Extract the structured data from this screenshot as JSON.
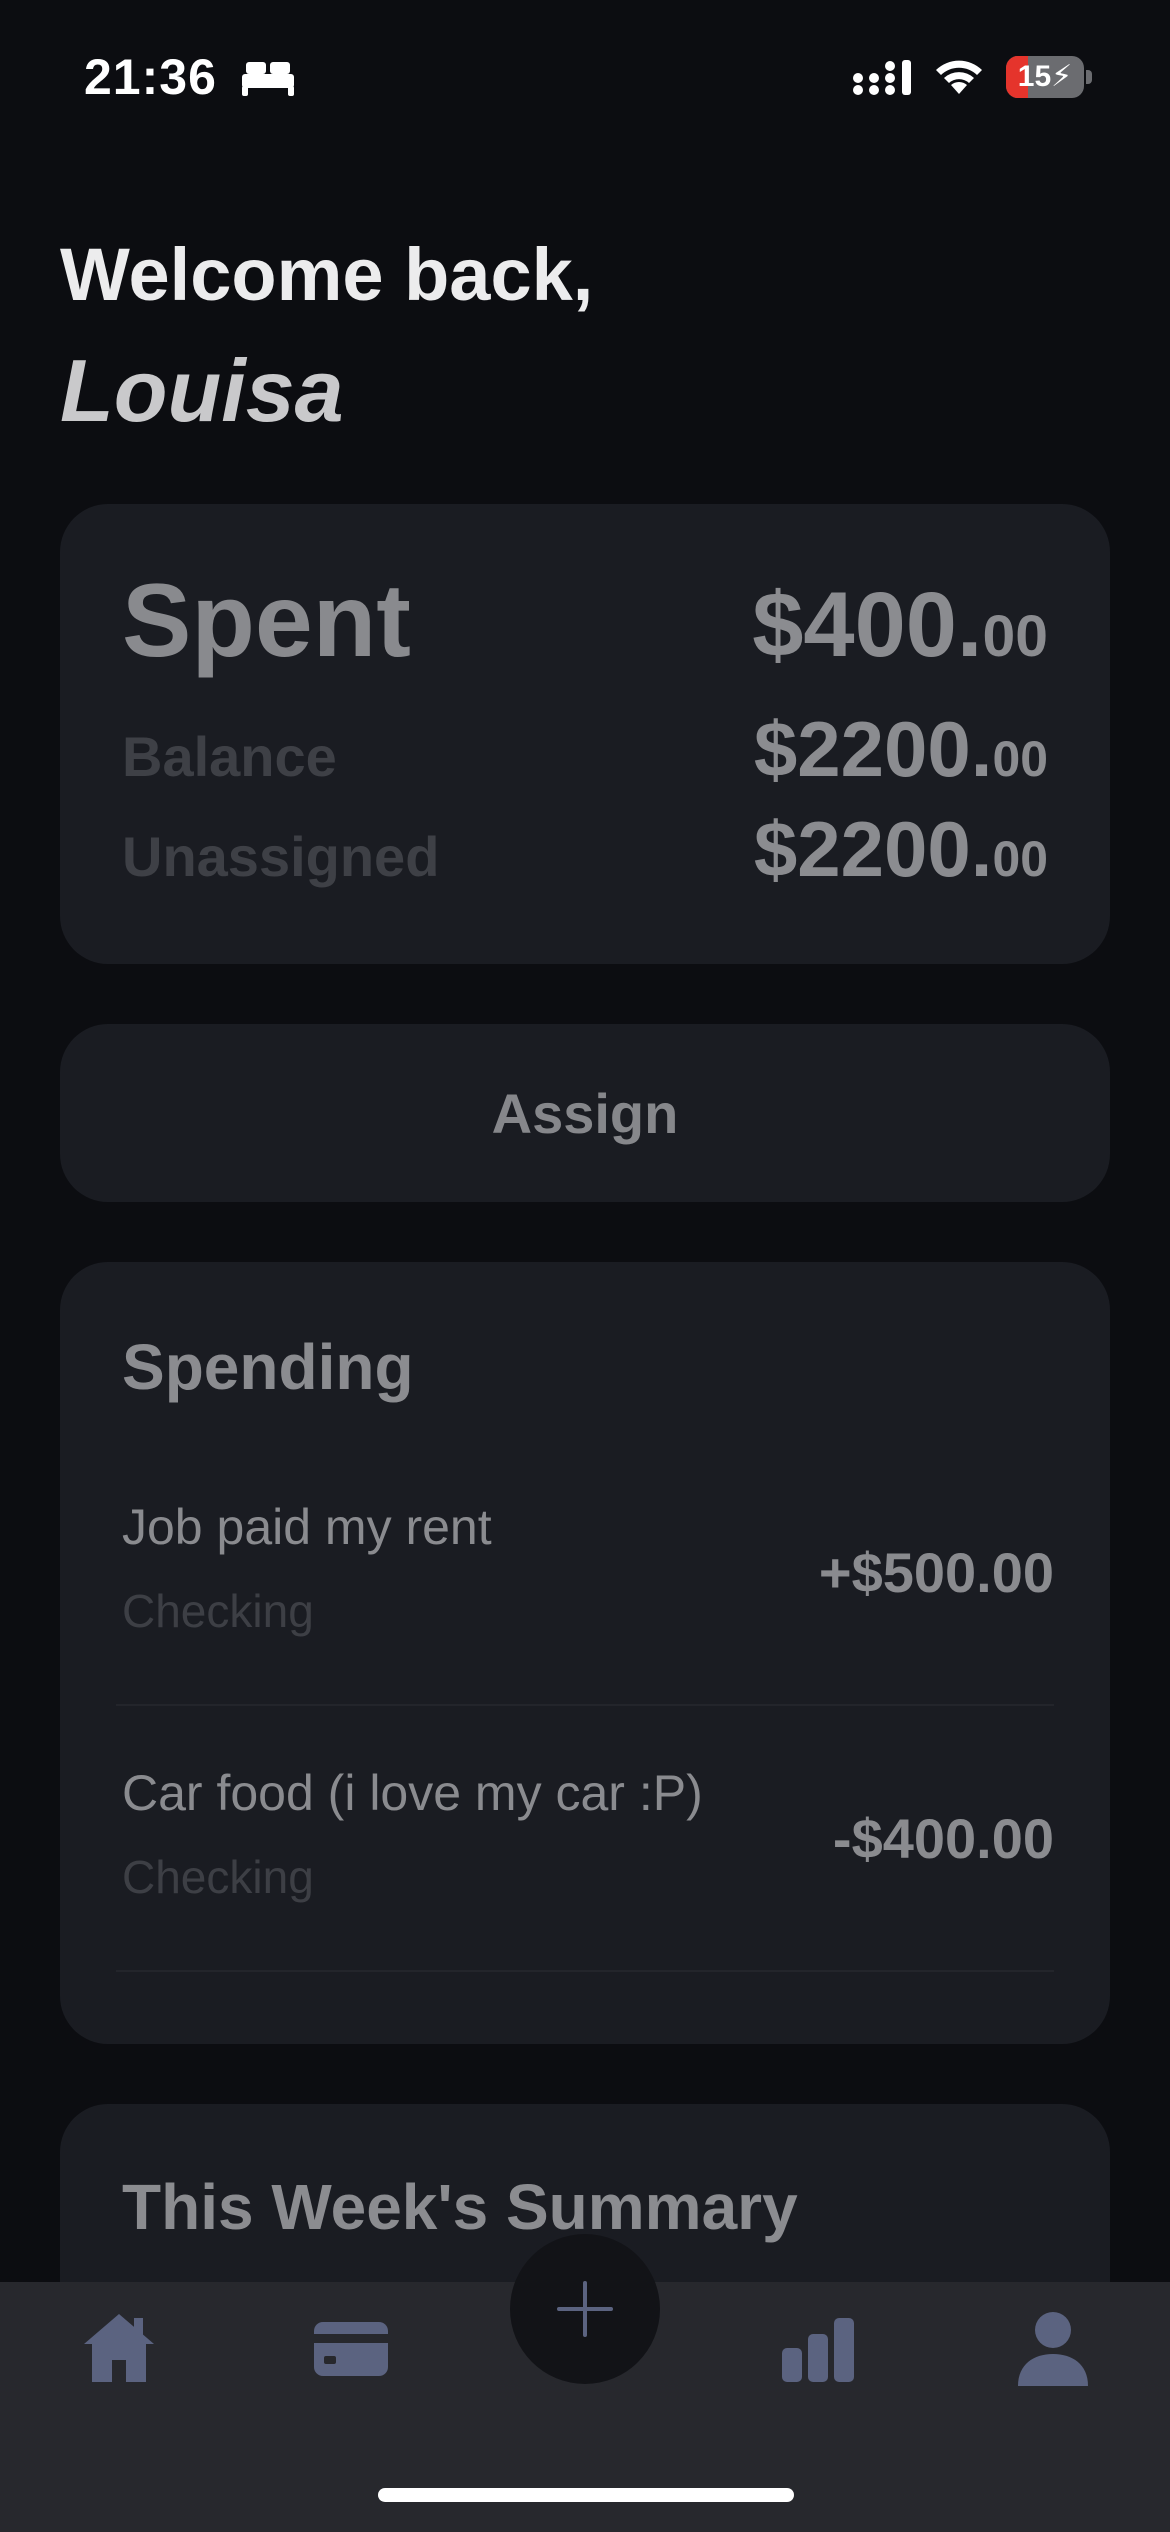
{
  "status_bar": {
    "time": "21:36",
    "battery_percent": "15",
    "battery_level": 0.15,
    "icons": [
      "bed-icon",
      "signal-icon",
      "wifi-icon",
      "battery-icon"
    ]
  },
  "greeting": {
    "line1": "Welcome back,",
    "name": "Louisa"
  },
  "summary": {
    "spent_label": "Spent",
    "spent_dollars": "$400.",
    "spent_cents": "00",
    "balance_label": "Balance",
    "balance_dollars": "$2200.",
    "balance_cents": "00",
    "unassigned_label": "Unassigned",
    "unassigned_dollars": "$2200.",
    "unassigned_cents": "00"
  },
  "assign_button": {
    "label": "Assign"
  },
  "spending": {
    "title": "Spending",
    "transactions": [
      {
        "name": "Job paid my rent",
        "account": "Checking",
        "amount": "+$500.00"
      },
      {
        "name": "Car food (i love my car :P)",
        "account": "Checking",
        "amount": "-$400.00"
      }
    ]
  },
  "weekly_summary": {
    "title": "This Week's Summary"
  },
  "bottom_nav": {
    "items": [
      "home-icon",
      "card-icon",
      "add-icon",
      "stats-icon",
      "profile-icon"
    ]
  },
  "colors": {
    "background": "#0c0d11",
    "card": "#1a1c22",
    "nav": "#27282d",
    "nav_icon": "#5b6380",
    "battery_low": "#e5342c"
  }
}
